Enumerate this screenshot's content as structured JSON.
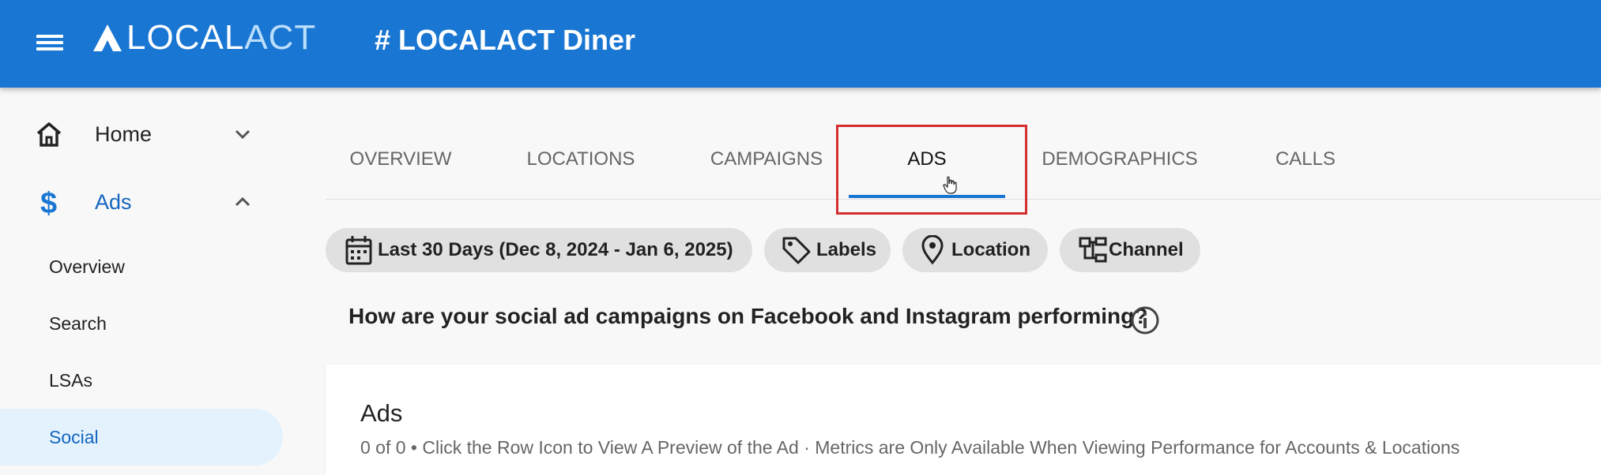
{
  "app": {
    "logo_text_a": "LOCAL",
    "logo_text_b": "ACT",
    "page_title": "# LOCALACT Diner"
  },
  "sidebar": {
    "home_label": "Home",
    "ads_label": "Ads",
    "sub_items": [
      "Overview",
      "Search",
      "LSAs",
      "Social"
    ]
  },
  "tabs": [
    "OVERVIEW",
    "LOCATIONS",
    "CAMPAIGNS",
    "ADS",
    "DEMOGRAPHICS",
    "CALLS"
  ],
  "filters": {
    "date_range": "Last 30 Days (Dec 8, 2024 - Jan 6, 2025)",
    "labels": "Labels",
    "location": "Location",
    "channel": "Channel"
  },
  "question": "How are your social ad campaigns on Facebook and Instagram performing?",
  "card": {
    "title": "Ads",
    "subtitle": "0 of 0 • Click the Row Icon to View A Preview of the Ad · Metrics are Only Available When Viewing Performance for Accounts & Locations"
  },
  "colors": {
    "brand": "#1976d2",
    "active_text": "#1565c0",
    "active_bg": "#e3f2fd",
    "highlight": "#d32f2f"
  },
  "icons": {
    "menu": "menu-icon",
    "home": "home-icon",
    "ads": "dollar-icon",
    "calendar": "calendar-icon",
    "labels": "tag-icon",
    "location": "location-pin-icon",
    "channel": "channel-tree-icon",
    "info": "info-icon"
  }
}
